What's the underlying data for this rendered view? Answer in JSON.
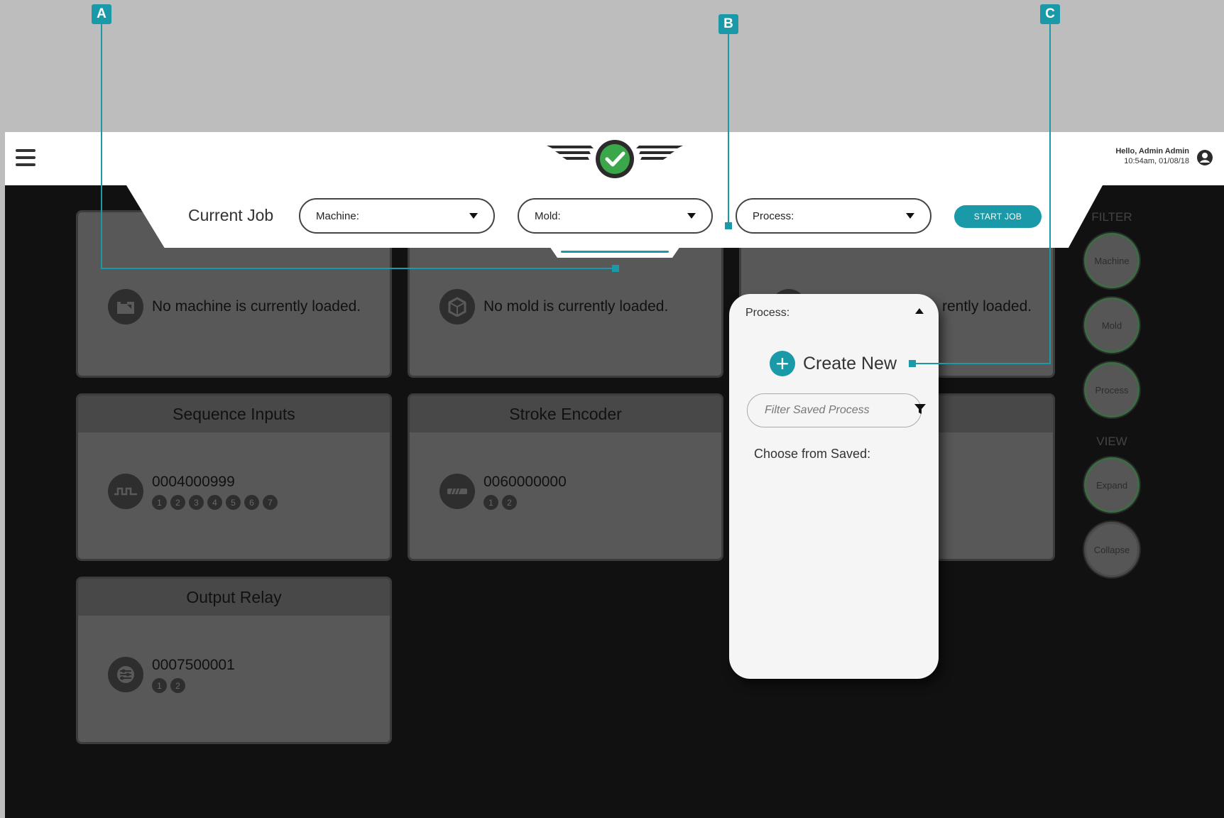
{
  "header": {
    "greeting": "Hello, Admin Admin",
    "datetime": "10:54am, 01/08/18",
    "menu_icon": "hamburger-icon",
    "user_icon": "user-circle-icon"
  },
  "job_bar": {
    "title": "Current Job",
    "machine_label": "Machine:",
    "mold_label": "Mold:",
    "process_label": "Process:",
    "start_label": "START JOB"
  },
  "cards": {
    "machine": {
      "text": "No machine is currently loaded.",
      "icon": "machine-icon"
    },
    "mold": {
      "text": "No mold is currently loaded.",
      "icon": "mold-icon"
    },
    "process": {
      "text": "rently loaded.",
      "icon": "process-icon"
    },
    "sequence_inputs": {
      "title": "Sequence Inputs",
      "serial": "0004000999",
      "icon": "pulse-icon",
      "channels": [
        "1",
        "2",
        "3",
        "4",
        "5",
        "6",
        "7"
      ]
    },
    "stroke_encoder": {
      "title": "Stroke Encoder",
      "serial": "0060000000",
      "icon": "encoder-icon",
      "channels": [
        "1",
        "2"
      ]
    },
    "output_relay": {
      "title": "Output Relay",
      "serial": "0007500001",
      "icon": "relay-icon",
      "channels": [
        "1",
        "2"
      ]
    }
  },
  "sidebar": {
    "filter_label": "FILTER",
    "filter_buttons": [
      "Machine",
      "Mold",
      "Process"
    ],
    "view_label": "VIEW",
    "view_buttons": [
      "Expand",
      "Collapse"
    ]
  },
  "process_popup": {
    "title": "Process:",
    "create_new": "Create New",
    "filter_placeholder": "Filter Saved Process",
    "choose_label": "Choose from Saved:"
  },
  "callouts": [
    "A",
    "B",
    "C"
  ],
  "colors": {
    "accent": "#1a9aa8",
    "background_dark": "#111111",
    "card": "#585858",
    "logo_check": "#3aa84a"
  }
}
